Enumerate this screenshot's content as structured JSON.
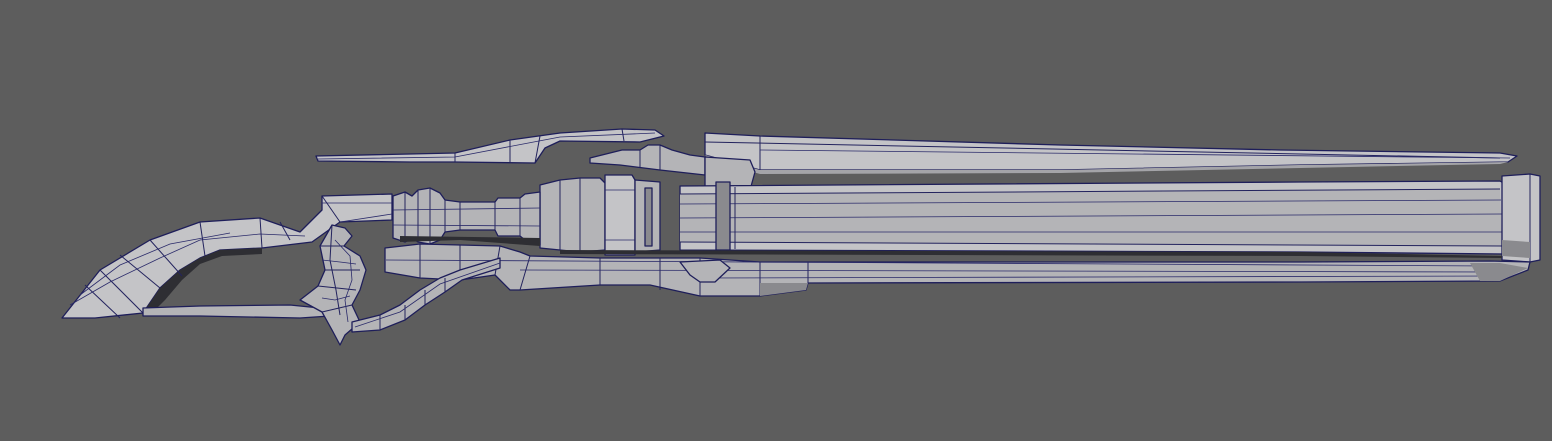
{
  "viewport": {
    "background_color": "#5d5d5d",
    "shading_mode": "wireframe-on-shaded",
    "mesh_fill_color": "#b4b4b7",
    "wire_color": "#23235e"
  },
  "model": {
    "object": "rifle",
    "parts": [
      "stock",
      "grip",
      "trigger-guard",
      "top-blade",
      "receiver",
      "barrel",
      "underbarrel",
      "muzzle"
    ]
  }
}
